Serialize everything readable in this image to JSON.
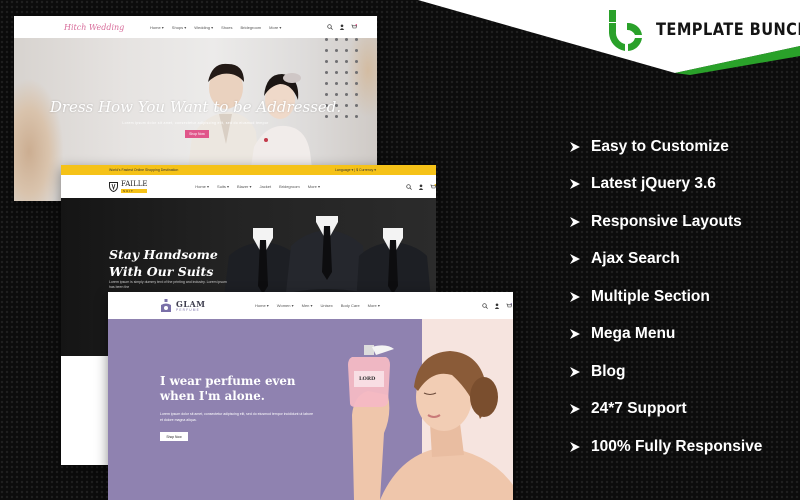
{
  "brand": {
    "name": "TEMPLATE BUNCH",
    "accent_color": "#2aa12a"
  },
  "features": [
    {
      "label": "Easy to Customize"
    },
    {
      "label": "Latest jQuery 3.6"
    },
    {
      "label": "Responsive Layouts"
    },
    {
      "label": "Ajax Search"
    },
    {
      "label": "Multiple Section"
    },
    {
      "label": "Mega Menu"
    },
    {
      "label": "Blog"
    },
    {
      "label": "24*7 Support"
    },
    {
      "label": "100% Fully Responsive"
    }
  ],
  "wedding": {
    "logo": "Hitch Wedding",
    "nav": [
      "Home ▾",
      "Shops ▾",
      "Wedding ▾",
      "Shoes",
      "Bridegroom",
      "More ▾"
    ],
    "hero_title": "Dress How You Want to be Addressed.",
    "hero_subtitle": "Lorem ipsum dolor sit amet, consectetur adipiscing elit, sed do eiusmod tempor",
    "cta": "Shop Now",
    "accent_color": "#e0568a"
  },
  "suits": {
    "topbar_left": "World's Fastest Online Shopping Destination",
    "topbar_right": "Language ▾  |  $ Currency ▾",
    "logo": "FAILLE",
    "logo_tag": "SUIT",
    "nav": [
      "Home ▾",
      "Suits ▾",
      "Blazer ▾",
      "Jacket",
      "Bridegroom",
      "More ▾"
    ],
    "hero_title_line1": "Stay Handsome",
    "hero_title_line2": "With Our Suits",
    "hero_subtitle": "Lorem ipsum is simply dummy text of the printing and industry. Lorem ipsum has been the",
    "accent_color": "#f5c218"
  },
  "perfume": {
    "logo": "GLAM",
    "logo_tag": "PERFUME",
    "nav": [
      "Home ▾",
      "Women ▾",
      "Men ▾",
      "Unisex",
      "Body Care",
      "More ▾"
    ],
    "hero_title_line1": "I wear perfume even",
    "hero_title_line2": "when I'm alone.",
    "hero_subtitle": "Lorem ipsum dolor sit amet, consectetur adipiscing elit, sed do eiusmod tempor incididunt ut labore et dolore magna aliqua.",
    "cta": "Shop Now",
    "bottle_label": "LORD",
    "accent_color": "#8f82b0"
  }
}
